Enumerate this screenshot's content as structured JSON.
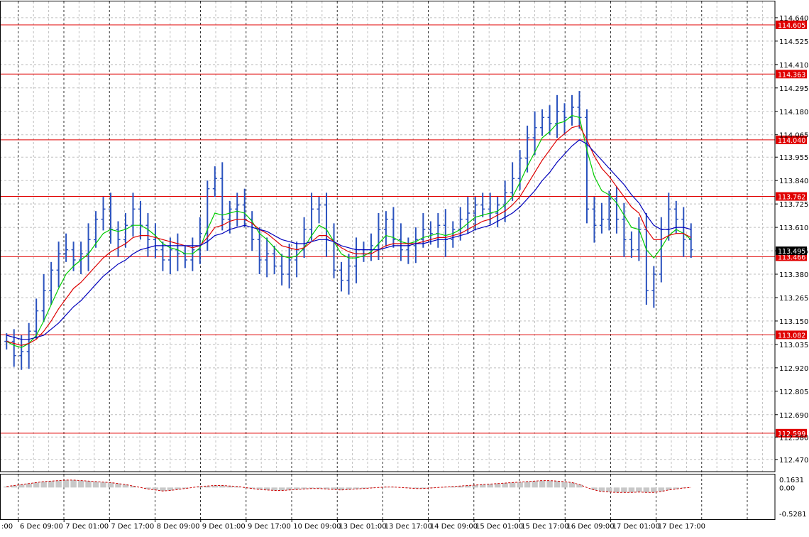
{
  "chart_data": {
    "type": "candlestick",
    "main": {
      "ylim": [
        112.41,
        114.72
      ],
      "y_ticks": [
        "114.640",
        "114.525",
        "114.410",
        "114.295",
        "114.180",
        "114.065",
        "113.955",
        "113.840",
        "113.725",
        "113.610",
        "113.495",
        "113.380",
        "113.265",
        "113.150",
        "113.035",
        "112.920",
        "112.805",
        "112.690",
        "112.580",
        "112.470"
      ],
      "levels": [
        "114.605",
        "114.363",
        "114.040",
        "113.762",
        "113.466",
        "113.082",
        "112.599"
      ],
      "current_price": "113.495",
      "x_labels": [
        "6 Dec 09:00",
        "7 Dec 01:00",
        "7 Dec 17:00",
        "8 Dec 09:00",
        "9 Dec 01:00",
        "9 Dec 17:00",
        "10 Dec 09:00",
        "13 Dec 01:00",
        "13 Dec 17:00",
        "14 Dec 09:00",
        "15 Dec 01:00",
        "15 Dec 17:00",
        "16 Dec 09:00",
        "17 Dec 01:00",
        "17 Dec 17:00"
      ],
      "x_label_first_partial": ":00",
      "series": [
        {
          "kind": "price",
          "values": [
            113.05,
            112.98,
            113.0,
            113.1,
            113.2,
            113.3,
            113.4,
            113.48,
            113.5,
            113.45,
            113.48,
            113.55,
            113.65,
            113.7,
            113.6,
            113.55,
            113.62,
            113.7,
            113.62,
            113.55,
            113.5,
            113.45,
            113.5,
            113.48,
            113.45,
            113.5,
            113.58,
            113.8,
            113.85,
            113.65,
            113.7,
            113.72,
            113.65,
            113.55,
            113.45,
            113.48,
            113.42,
            113.38,
            113.45,
            113.5,
            113.6,
            113.7,
            113.72,
            113.55,
            113.4,
            113.35,
            113.42,
            113.48,
            113.5,
            113.52,
            113.6,
            113.65,
            113.55,
            113.5,
            113.52,
            113.55,
            113.6,
            113.58,
            113.62,
            113.55,
            113.6,
            113.65,
            113.68,
            113.72,
            113.7,
            113.68,
            113.72,
            113.78,
            113.85,
            113.95,
            114.05,
            114.1,
            114.15,
            114.12,
            114.18,
            114.15,
            114.2,
            114.15,
            113.7,
            113.62,
            113.65,
            113.75,
            113.65,
            113.55,
            113.5,
            113.6,
            113.3,
            113.38,
            113.6,
            113.7,
            113.65,
            113.55,
            113.5
          ]
        },
        {
          "kind": "ma_fast",
          "values": [
            113.05,
            113.03,
            113.02,
            113.04,
            113.08,
            113.15,
            113.23,
            113.31,
            113.38,
            113.42,
            113.45,
            113.48,
            113.53,
            113.58,
            113.6,
            113.59,
            113.6,
            113.62,
            113.62,
            113.6,
            113.57,
            113.53,
            113.51,
            113.5,
            113.48,
            113.48,
            113.51,
            113.6,
            113.68,
            113.67,
            113.68,
            113.69,
            113.68,
            113.64,
            113.58,
            113.55,
            113.51,
            113.47,
            113.46,
            113.47,
            113.51,
            113.57,
            113.62,
            113.6,
            113.54,
            113.48,
            113.46,
            113.46,
            113.47,
            113.49,
            113.53,
            113.57,
            113.56,
            113.54,
            113.53,
            113.54,
            113.56,
            113.57,
            113.58,
            113.57,
            113.58,
            113.6,
            113.63,
            113.66,
            113.67,
            113.68,
            113.69,
            113.72,
            113.76,
            113.83,
            113.91,
            113.98,
            114.05,
            114.08,
            114.12,
            114.13,
            114.16,
            114.15,
            113.99,
            113.86,
            113.79,
            113.77,
            113.73,
            113.67,
            113.61,
            113.6,
            113.5,
            113.46,
            113.51,
            113.57,
            113.6,
            113.58,
            113.55
          ]
        },
        {
          "kind": "ma_mid",
          "values": [
            113.05,
            113.04,
            113.03,
            113.04,
            113.06,
            113.1,
            113.15,
            113.21,
            113.26,
            113.31,
            113.34,
            113.38,
            113.42,
            113.46,
            113.49,
            113.51,
            113.53,
            113.56,
            113.57,
            113.57,
            113.56,
            113.55,
            113.54,
            113.53,
            113.52,
            113.51,
            113.52,
            113.56,
            113.61,
            113.62,
            113.64,
            113.65,
            113.65,
            113.63,
            113.6,
            113.58,
            113.55,
            113.52,
            113.51,
            113.5,
            113.51,
            113.54,
            113.57,
            113.57,
            113.54,
            113.51,
            113.49,
            113.48,
            113.48,
            113.48,
            113.5,
            113.52,
            113.53,
            113.53,
            113.53,
            113.53,
            113.54,
            113.55,
            113.56,
            113.56,
            113.57,
            113.58,
            113.6,
            113.62,
            113.64,
            113.65,
            113.67,
            113.69,
            113.72,
            113.76,
            113.82,
            113.88,
            113.94,
            113.99,
            114.04,
            114.07,
            114.1,
            114.11,
            114.04,
            113.96,
            113.9,
            113.86,
            113.81,
            113.76,
            113.71,
            113.68,
            113.6,
            113.55,
            113.55,
            113.57,
            113.58,
            113.58,
            113.56
          ]
        },
        {
          "kind": "ma_slow",
          "values": [
            113.08,
            113.07,
            113.06,
            113.06,
            113.07,
            113.08,
            113.11,
            113.14,
            113.18,
            113.22,
            113.25,
            113.29,
            113.33,
            113.37,
            113.4,
            113.43,
            113.45,
            113.48,
            113.5,
            113.51,
            113.52,
            113.52,
            113.52,
            113.52,
            113.52,
            113.52,
            113.52,
            113.54,
            113.57,
            113.58,
            113.6,
            113.61,
            113.62,
            113.61,
            113.6,
            113.59,
            113.57,
            113.55,
            113.54,
            113.53,
            113.53,
            113.54,
            113.55,
            113.55,
            113.54,
            113.52,
            113.51,
            113.5,
            113.5,
            113.5,
            113.5,
            113.51,
            113.52,
            113.52,
            113.52,
            113.53,
            113.53,
            113.54,
            113.55,
            113.55,
            113.56,
            113.57,
            113.58,
            113.6,
            113.61,
            113.62,
            113.64,
            113.66,
            113.68,
            113.71,
            113.75,
            113.79,
            113.84,
            113.88,
            113.93,
            113.97,
            114.01,
            114.04,
            114.02,
            113.98,
            113.94,
            113.9,
            113.86,
            113.82,
            113.77,
            113.73,
            113.67,
            113.62,
            113.6,
            113.6,
            113.61,
            113.61,
            113.6
          ]
        }
      ]
    },
    "oscillator": {
      "ylim": [
        -0.5281,
        0.1631
      ],
      "y_ticks": [
        "0.1631",
        "0.00",
        "-0.5281"
      ],
      "values": [
        0.02,
        0.04,
        0.06,
        0.08,
        0.1,
        0.12,
        0.13,
        0.14,
        0.15,
        0.15,
        0.14,
        0.13,
        0.12,
        0.11,
        0.1,
        0.08,
        0.06,
        0.03,
        0.0,
        -0.03,
        -0.05,
        -0.07,
        -0.06,
        -0.04,
        -0.02,
        0.0,
        0.02,
        0.03,
        0.04,
        0.04,
        0.03,
        0.02,
        0.0,
        -0.02,
        -0.04,
        -0.05,
        -0.06,
        -0.06,
        -0.05,
        -0.04,
        -0.03,
        -0.02,
        -0.02,
        -0.03,
        -0.04,
        -0.05,
        -0.04,
        -0.03,
        -0.02,
        -0.01,
        0.0,
        0.01,
        0.01,
        0.0,
        -0.01,
        -0.02,
        -0.02,
        -0.01,
        0.0,
        0.01,
        0.02,
        0.03,
        0.04,
        0.05,
        0.06,
        0.07,
        0.08,
        0.09,
        0.1,
        0.11,
        0.12,
        0.13,
        0.14,
        0.14,
        0.13,
        0.12,
        0.1,
        0.06,
        0.0,
        -0.05,
        -0.08,
        -0.09,
        -0.1,
        -0.1,
        -0.1,
        -0.09,
        -0.1,
        -0.1,
        -0.08,
        -0.05,
        -0.03,
        -0.01,
        0.0
      ]
    },
    "colors": {
      "price": "#2a52be",
      "ma_fast": "#00cc00",
      "ma_mid": "#dd0000",
      "ma_slow": "#0000bb",
      "level": "#e00000",
      "level_label_bg": "#e00000",
      "current_label_bg": "#000000",
      "grid": "#bfbfbf",
      "oscillator": "#cc0000"
    }
  }
}
